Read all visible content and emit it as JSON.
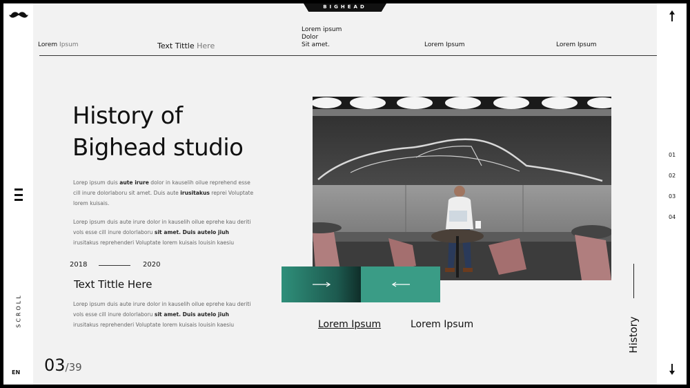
{
  "brand": "BIGHEAD",
  "nav": {
    "item1": {
      "a": "Lorem",
      "b": "Ipsum"
    },
    "item2": {
      "a": "Text Tittle",
      "b": "Here"
    },
    "item3": {
      "l1": "Lorem ipsum",
      "l2": "Dolor",
      "l3": "Sit amet."
    },
    "item4": "Lorem Ipsum",
    "item5": "Lorem Ipsum"
  },
  "left_rail": {
    "scroll": "SCROLL",
    "lang": "EN"
  },
  "right_rail": {
    "pages": [
      "01",
      "02",
      "03",
      "04"
    ]
  },
  "content": {
    "headline_l1": "History of",
    "headline_l2": "Bighead studio",
    "p1": {
      "a": "Lorep  ipsum duis ",
      "b": "aute irure",
      "c": " dolor in kauselih oilue reprehend esse cill inure dolorlaboru  sit amet. Duis aute ",
      "d": "irusitakus",
      "e": "  reprei Voluptate  lorem kuisais."
    },
    "p2": {
      "a": "Lorep  ipsum duis aute irure dolor in kauselih oilue eprehe kau deriti vols esse cill inure dolorlaboru  ",
      "b": "sit amet. Duis autelo jiuh",
      "c": " irusitakus  reprehenderi  Voluptate  lorem kuisais louisin kaesiu"
    },
    "timeline": {
      "start": "2018",
      "end": "2020"
    },
    "subhead": "Text Tittle Here",
    "p3": {
      "a": "Lorep  ipsum duis aute irure dolor in kauselih oilue eprehe kau deriti vols esse cill inure dolorlaboru  ",
      "b": "sit amet. Duis autelo jiuh",
      "c": " irusitakus  reprehenderi  Voluptate  lorem kuisais louisin kaesiu"
    },
    "link1": "Lorem Ipsum",
    "link2": "Lorem Ipsum",
    "history": "History"
  },
  "pager": {
    "current": "03",
    "total": "/39"
  },
  "icons": {
    "logo": "mustache-icon",
    "menu": "hamburger-icon",
    "prev": "arrow-right-icon",
    "next": "arrow-left-icon",
    "up": "arrow-up-icon",
    "down": "arrow-down-icon"
  },
  "colors": {
    "accent": "#3a9c86",
    "accent_dark": "#1d5a4f",
    "background": "#f2f2f2"
  }
}
